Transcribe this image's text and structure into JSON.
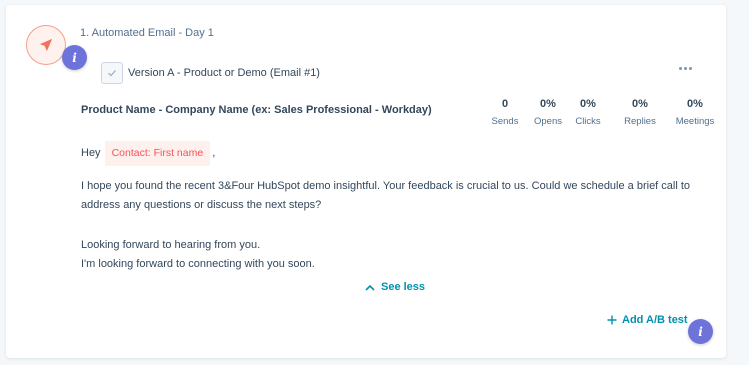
{
  "step": {
    "title": "1. Automated Email - Day 1",
    "icon": "paper-plane-icon",
    "accent": "#f2735d"
  },
  "info_badge": {
    "text": "i",
    "color": "#6d73d9"
  },
  "version": {
    "label": "Version A - Product or Demo (Email #1)",
    "more_icon": "ellipsis-icon"
  },
  "email": {
    "subject": "Product Name - Company Name (ex: Sales Professional - Workday)",
    "greeting": "Hey",
    "token": "Contact: First name",
    "greeting_suffix": ",",
    "paragraph1": "I hope you found the recent 3&Four HubSpot demo insightful. Your feedback is crucial to us. Could we schedule a brief call to address any questions or discuss the next steps?",
    "paragraph2": "Looking forward to hearing from you.",
    "paragraph3": "I'm looking forward to connecting with you soon."
  },
  "stats": [
    {
      "value": "0",
      "label": "Sends"
    },
    {
      "value": "0%",
      "label": "Opens"
    },
    {
      "value": "0%",
      "label": "Clicks"
    },
    {
      "value": "0%",
      "label": "Replies"
    },
    {
      "value": "0%",
      "label": "Meetings"
    }
  ],
  "actions": {
    "see_less": "See less",
    "add_ab_test": "Add A/B test",
    "link_color": "#0091ae"
  }
}
